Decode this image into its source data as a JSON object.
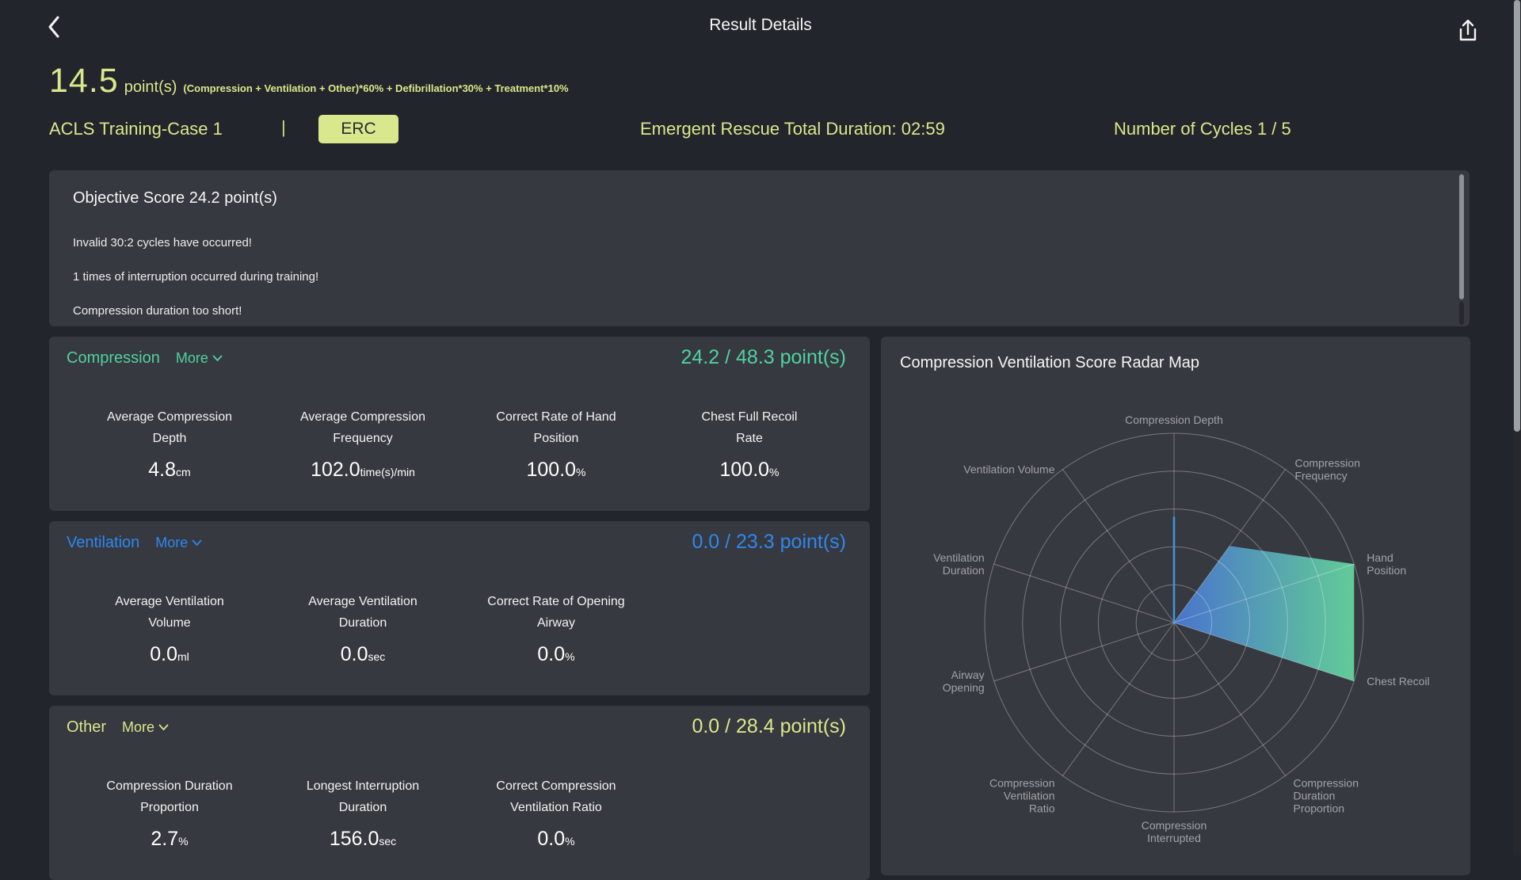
{
  "header": {
    "title": "Result Details"
  },
  "score_summary": {
    "score": "14.5",
    "unit": "point(s)",
    "formula": "(Compression + Ventilation + Other)*60% + Defibrillation*30% + Treatment*10%"
  },
  "session": {
    "case_name": "ACLS Training-Case 1",
    "separator": "|",
    "guideline_badge": "ERC",
    "total_duration": "Emergent Rescue Total Duration: 02:59",
    "cycles": "Number of Cycles 1 / 5"
  },
  "objective": {
    "title": "Objective Score 24.2 point(s)",
    "warnings": [
      "Invalid 30:2 cycles have occurred!",
      "1 times of interruption occurred during training!",
      "Compression duration too short!"
    ]
  },
  "sections": [
    {
      "name": "Compression",
      "more_label": "More",
      "score": "24.2 / 48.3 point(s)",
      "accent": "#50d2a0",
      "metrics": [
        {
          "label": "Average Compression\nDepth",
          "value": "4.8",
          "unit": "cm"
        },
        {
          "label": "Average Compression\nFrequency",
          "value": "102.0",
          "unit": "time(s)/min"
        },
        {
          "label": "Correct Rate of Hand\nPosition",
          "value": "100.0",
          "unit": "%"
        },
        {
          "label": "Chest Full Recoil\nRate",
          "value": "100.0",
          "unit": "%"
        }
      ]
    },
    {
      "name": "Ventilation",
      "more_label": "More",
      "score": "0.0 / 23.3 point(s)",
      "accent": "#2f87f0",
      "metrics": [
        {
          "label": "Average Ventilation\nVolume",
          "value": "0.0",
          "unit": "ml"
        },
        {
          "label": "Average Ventilation\nDuration",
          "value": "0.0",
          "unit": "sec"
        },
        {
          "label": "Correct Rate of Opening\nAirway",
          "value": "0.0",
          "unit": "%"
        }
      ]
    },
    {
      "name": "Other",
      "more_label": "More",
      "score": "0.0 / 28.4 point(s)",
      "accent": "#d9e88c",
      "metrics": [
        {
          "label": "Compression Duration\nProportion",
          "value": "2.7",
          "unit": "%"
        },
        {
          "label": "Longest Interruption\nDuration",
          "value": "156.0",
          "unit": "sec"
        },
        {
          "label": "Correct Compression\nVentilation Ratio",
          "value": "0.0",
          "unit": "%"
        }
      ]
    }
  ],
  "radar_panel": {
    "title": "Compression Ventilation Score Radar Map"
  },
  "chart_data": {
    "type": "radar",
    "title": "Compression Ventilation Score Radar Map",
    "max": 100,
    "rings": 5,
    "grid_shape": "circle",
    "legend": "none",
    "indicators": [
      {
        "name": "Compression Depth",
        "lines": [
          "Compression Depth"
        ],
        "value": 56
      },
      {
        "name": "Compression Frequency",
        "lines": [
          "Compression",
          "Frequency"
        ],
        "value": 50
      },
      {
        "name": "Hand Position",
        "lines": [
          "Hand",
          "Position"
        ],
        "value": 100
      },
      {
        "name": "Chest Recoil",
        "lines": [
          "Chest Recoil"
        ],
        "value": 100
      },
      {
        "name": "Compression Duration Proportion",
        "lines": [
          "Compression",
          "Duration",
          "Proportion"
        ],
        "value": 0
      },
      {
        "name": "Compression Interrupted",
        "lines": [
          "Compression",
          "Interrupted"
        ],
        "value": 0
      },
      {
        "name": "Compression Ventilation Ratio",
        "lines": [
          "Compression",
          "Ventilation",
          "Ratio"
        ],
        "value": 0
      },
      {
        "name": "Airway Opening",
        "lines": [
          "Airway",
          "Opening"
        ],
        "value": 0
      },
      {
        "name": "Ventilation Duration",
        "lines": [
          "Ventilation",
          "Duration"
        ],
        "value": 0
      },
      {
        "name": "Ventilation Volume",
        "lines": [
          "Ventilation Volume"
        ],
        "value": 0
      }
    ],
    "series": [
      {
        "name": "Score polygon",
        "fill_gradient": [
          "#4a78d8",
          "#65d79e"
        ],
        "values_note": "polygon drawn through non-zero indicators except Compression Depth, which renders as an axis spike line"
      }
    ],
    "spike": {
      "index": 0,
      "value": 56,
      "color": "#3e97d8"
    },
    "grid_color": "rgba(255,255,255,0.32)",
    "label_color": "#a0a3a7"
  }
}
